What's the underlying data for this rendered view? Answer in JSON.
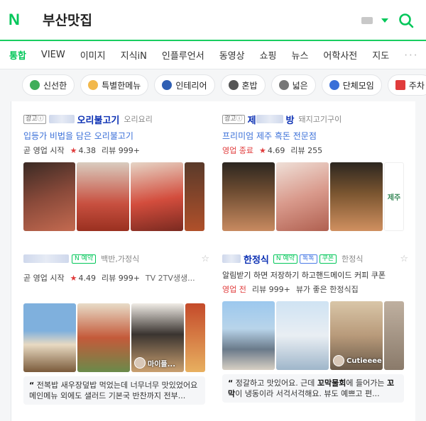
{
  "search": {
    "logo": "N",
    "query": "부산맛집"
  },
  "tabs": [
    "통합",
    "VIEW",
    "이미지",
    "지식iN",
    "인플루언서",
    "동영상",
    "쇼핑",
    "뉴스",
    "어학사전",
    "지도"
  ],
  "tabs_more": "···",
  "chips": [
    {
      "label": "신선한",
      "icon": "leaf-icon",
      "color": "#3fae5a"
    },
    {
      "label": "특별한메뉴",
      "icon": "chef-icon",
      "color": "#f2b84b"
    },
    {
      "label": "인테리어",
      "icon": "sofa-icon",
      "color": "#2f5fb3"
    },
    {
      "label": "혼밥",
      "icon": "bowl-icon",
      "color": "#555555"
    },
    {
      "label": "넓은",
      "icon": "eyes-icon",
      "color": "#777777"
    },
    {
      "label": "단체모임",
      "icon": "people-icon",
      "color": "#3a6fd8"
    },
    {
      "label": "주차",
      "icon": "parking-icon",
      "color": "#e03b3b"
    }
  ],
  "cards": [
    {
      "ad": "광고ⓘ",
      "name": "오리불고기",
      "category": "오리요리",
      "headline": "입등가 비법을 담은 오리불고기",
      "status": "곧 영업 시작",
      "rating": "4.38",
      "reviews": "리뷰 999+"
    },
    {
      "ad": "광고ⓘ",
      "name": "방",
      "name_prefix": "제",
      "category": "돼지고기구이",
      "headline": "프리미엄 제주 흑돈 전문점",
      "status": "영업 종료",
      "rating": "4.69",
      "reviews": "리뷰 255",
      "photo_label": "제주"
    },
    {
      "badge_naver": "N 예약",
      "category": "백반,가정식",
      "status": "곧 영업 시작",
      "rating": "4.49",
      "reviews": "리뷰 999+",
      "extra": "TV 2TV생생...",
      "photo_tag": "마이플...",
      "review_text": "전복밥 새우장덮밥 먹었는데 너무너무 맛있었어요 메인메뉴 외에도 샐러드 기본국 반찬까지 전부..."
    },
    {
      "name": "한정식",
      "badge_naver": "N 예약",
      "badge_talk": "톡톡",
      "badge_coupon": "쿠폰",
      "category": "한정식",
      "alert": "알림받기 하면 저장하기 하고핸드메이드 커피 쿠폰",
      "status": "영업 전",
      "reviews": "리뷰 999+",
      "view": "뷰가 좋은 한정식집",
      "photo_tag": "Cutieeee",
      "review_text_a": "정갈하고 맛있어요. 근데 ",
      "review_bold_1": "꼬막물회",
      "review_text_b": "에 들어가는 ",
      "review_bold_2": "꼬막",
      "review_text_c": "이 냉동이라 서걱서걱해요. 뷰도 예쁘고 편..."
    }
  ],
  "colors": {
    "brand": "#03c75a",
    "link": "#0a2fb3",
    "headline": "#3a6fd8",
    "rating": "#e03b3b"
  }
}
